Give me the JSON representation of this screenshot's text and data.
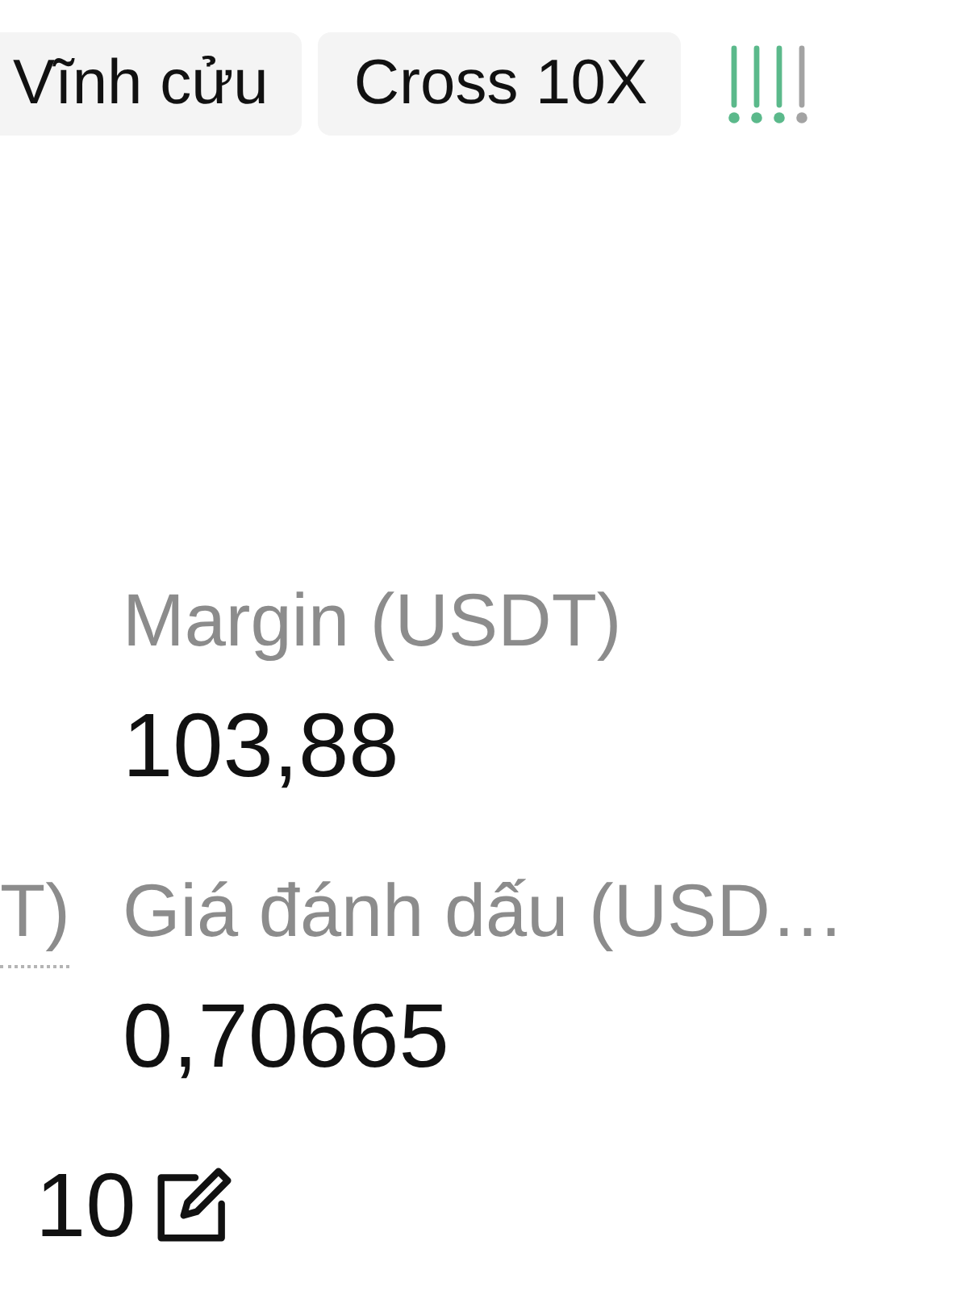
{
  "tags": [
    {
      "label": "Vĩnh cửu"
    },
    {
      "label": "Cross 10X"
    }
  ],
  "rows": [
    {
      "column_2": {
        "label": "Margin (USDT)",
        "value": "103,88",
        "dotted_underline": false
      }
    },
    {
      "column_1": {
        "label": "T)",
        "dotted_underline": true
      },
      "column_2": {
        "label": "Giá đánh dấu (USD…",
        "value": "0,70665",
        "dotted_underline": false
      }
    },
    {
      "column_1": {
        "value": "10",
        "editable": true
      }
    }
  ]
}
